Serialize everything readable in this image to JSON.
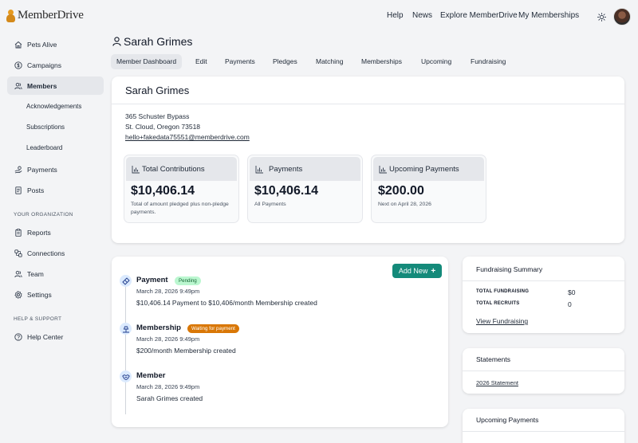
{
  "app": {
    "logo": "MemberDrive"
  },
  "topnav": [
    "Help",
    "News",
    "Explore MemberDrive",
    "My Memberships"
  ],
  "sidebar": {
    "items": [
      {
        "label": "Pets Alive",
        "icon": "home-icon"
      },
      {
        "label": "Campaigns",
        "icon": "dollar-icon"
      },
      {
        "label": "Members",
        "icon": "users-icon",
        "active": true
      },
      {
        "label": "Payments",
        "icon": "hand-coin-icon"
      },
      {
        "label": "Posts",
        "icon": "document-icon"
      }
    ],
    "member_subitems": [
      "Acknowledgements",
      "Subscriptions",
      "Leaderboard"
    ],
    "org_header": "YOUR ORGANIZATION",
    "org_items": [
      {
        "label": "Reports",
        "icon": "clipboard-icon"
      },
      {
        "label": "Connections",
        "icon": "link-icon"
      },
      {
        "label": "Team",
        "icon": "team-icon"
      },
      {
        "label": "Settings",
        "icon": "gear-icon"
      }
    ],
    "help_header": "HELP & SUPPORT",
    "help_items": [
      {
        "label": "Help Center",
        "icon": "question-icon"
      }
    ]
  },
  "page": {
    "title": "Sarah Grimes"
  },
  "tabs": [
    "Member Dashboard",
    "Edit",
    "Payments",
    "Pledges",
    "Matching",
    "Memberships",
    "Upcoming",
    "Fundraising"
  ],
  "profile": {
    "name": "Sarah Grimes",
    "address_line1": "365 Schuster Bypass",
    "address_line2": "St. Cloud, Oregon 73518",
    "email": "hello+fakedata75551@memberdrive.com"
  },
  "stats": [
    {
      "title": "Total Contributions",
      "value": "$10,406.14",
      "desc": "Total of amount pledged plus non-pledge payments."
    },
    {
      "title": "Payments",
      "value": "$10,406.14",
      "desc": "All Payments"
    },
    {
      "title": "Upcoming Payments",
      "value": "$200.00",
      "desc": "Next on April 28, 2026"
    }
  ],
  "timeline": {
    "add_new_label": "Add New",
    "events": [
      {
        "title": "Payment",
        "badge": "Pending",
        "date": "March 28, 2026 9:49pm",
        "desc": "$10,406.14 Payment to $10,406/month Membership created"
      },
      {
        "title": "Membership",
        "badge": "Waiting for payment",
        "date": "March 28, 2026 9:49pm",
        "desc": "$200/month Membership created"
      },
      {
        "title": "Member",
        "badge": "",
        "date": "March 28, 2026 9:49pm",
        "desc": "Sarah Grimes created"
      }
    ]
  },
  "fundraising": {
    "title": "Fundraising Summary",
    "total_fundraising_label": "TOTAL FUNDRAISING",
    "total_fundraising_value": "$0",
    "total_recruits_label": "TOTAL RECRUITS",
    "total_recruits_value": "0",
    "link": "View Fundraising"
  },
  "statements": {
    "title": "Statements",
    "link": "2026 Statement"
  },
  "upcoming_payments": {
    "title": "Upcoming Payments"
  },
  "colors": {
    "accent": "#148a7a",
    "pending_badge": "#bbf7d0",
    "waiting_badge": "#d97706"
  }
}
